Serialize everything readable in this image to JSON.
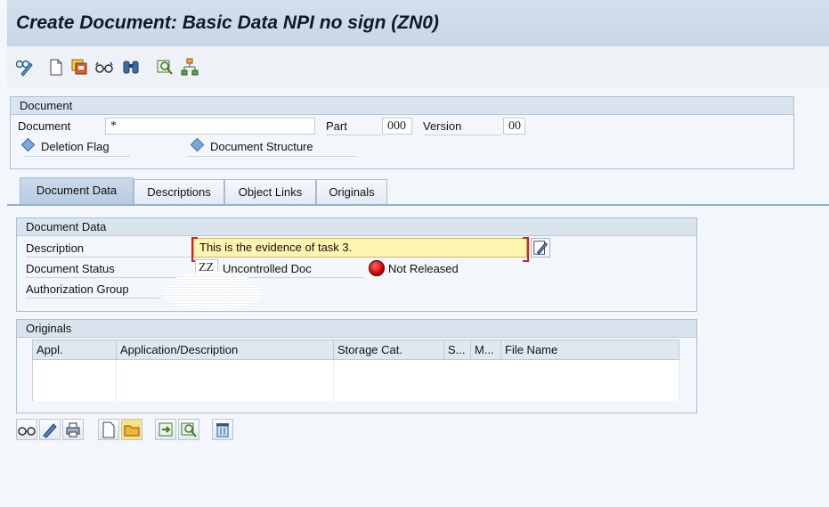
{
  "window": {
    "title": "Create Document: Basic Data NPI no sign (ZN0)"
  },
  "toolbar": {
    "icons": [
      "change-display-icon",
      "new-document-icon",
      "save-copy-icon",
      "display-glasses-icon",
      "binoculars-icon",
      "object-search-icon",
      "hierarchy-icon"
    ]
  },
  "document_group": {
    "header": "Document",
    "document_label": "Document",
    "document_value": "*",
    "part_label": "Part",
    "part_value": "000",
    "version_label": "Version",
    "version_value": "00",
    "deletion_flag_label": "Deletion Flag",
    "document_structure_label": "Document Structure"
  },
  "tabs": [
    {
      "label": "Document Data",
      "active": true
    },
    {
      "label": "Descriptions",
      "active": false
    },
    {
      "label": "Object Links",
      "active": false
    },
    {
      "label": "Originals",
      "active": false
    }
  ],
  "document_data": {
    "header": "Document Data",
    "description_label": "Description",
    "description_value": "This is the evidence of task 3.",
    "status_label": "Document Status",
    "status_code": "ZZ",
    "status_text": "Uncontrolled Doc",
    "release_text": "Not Released",
    "release_color": "#d00000",
    "authorization_label": "Authorization Group"
  },
  "originals": {
    "header": "Originals",
    "columns": [
      "Appl.",
      "Application/Description",
      "Storage Cat.",
      "S...",
      "M...",
      "File Name"
    ]
  },
  "bottom_toolbar": {
    "icons": [
      "display-icon",
      "change-pencil-icon",
      "print-icon",
      "create-icon",
      "open-folder-icon",
      "checkin-icon",
      "search-icon",
      "delete-icon"
    ]
  }
}
